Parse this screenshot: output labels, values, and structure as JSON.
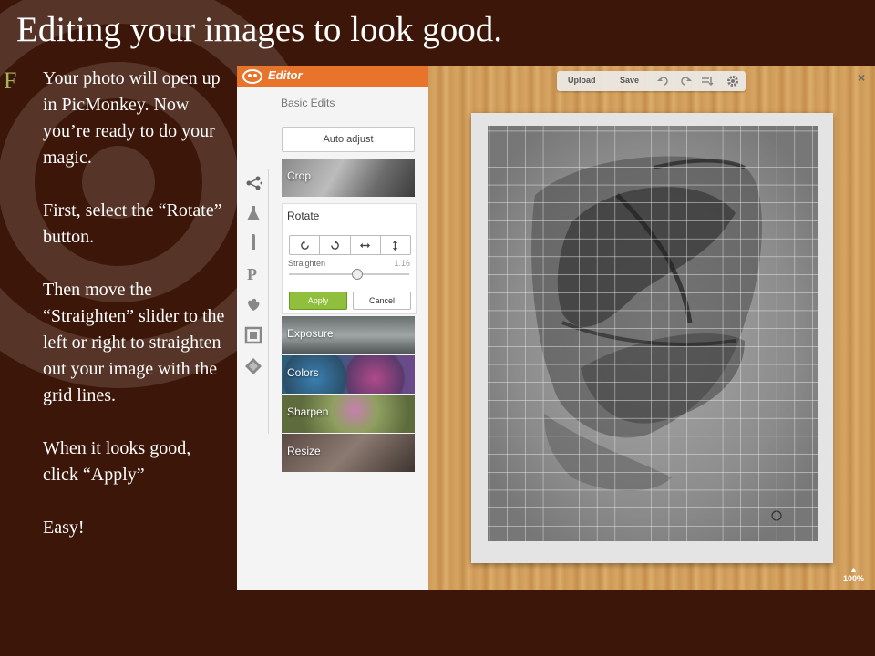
{
  "slide": {
    "title": "Editing your images to look good.",
    "bullet": "F",
    "paragraphs": [
      "Your photo will open up in PicMonkey. Now you’re ready to do your magic.",
      "First, select the “Rotate” button.",
      "Then move the “Straighten” slider to the left or right to straighten out your image with the grid lines.",
      "When it looks good, click “Apply”",
      "Easy!"
    ]
  },
  "editor": {
    "app_label": "Editor",
    "section_title": "Basic Edits",
    "auto_adjust_label": "Auto adjust",
    "tiles": {
      "crop": "Crop",
      "exposure": "Exposure",
      "colors": "Colors",
      "sharpen": "Sharpen",
      "resize": "Resize"
    },
    "rotate": {
      "title": "Rotate",
      "straighten_label": "Straighten",
      "straighten_value": "1.16",
      "slider_fraction": 0.57,
      "apply_label": "Apply",
      "cancel_label": "Cancel"
    },
    "toolbar": {
      "upload_label": "Upload",
      "save_label": "Save"
    },
    "close_label": "×",
    "zoom": {
      "arrow": "▲",
      "level": "100%"
    },
    "icons": [
      "effects-icon",
      "touch-up-icon",
      "textures-icon",
      "text-icon",
      "overlays-icon",
      "frames-icon",
      "themes-icon",
      "undo-icon",
      "redo-icon",
      "history-icon",
      "settings-icon"
    ]
  },
  "colors": {
    "background": "#3b1609",
    "accent_orange": "#e8742c",
    "apply_green": "#8fbf3c",
    "bullet_green": "#a6b35a"
  }
}
